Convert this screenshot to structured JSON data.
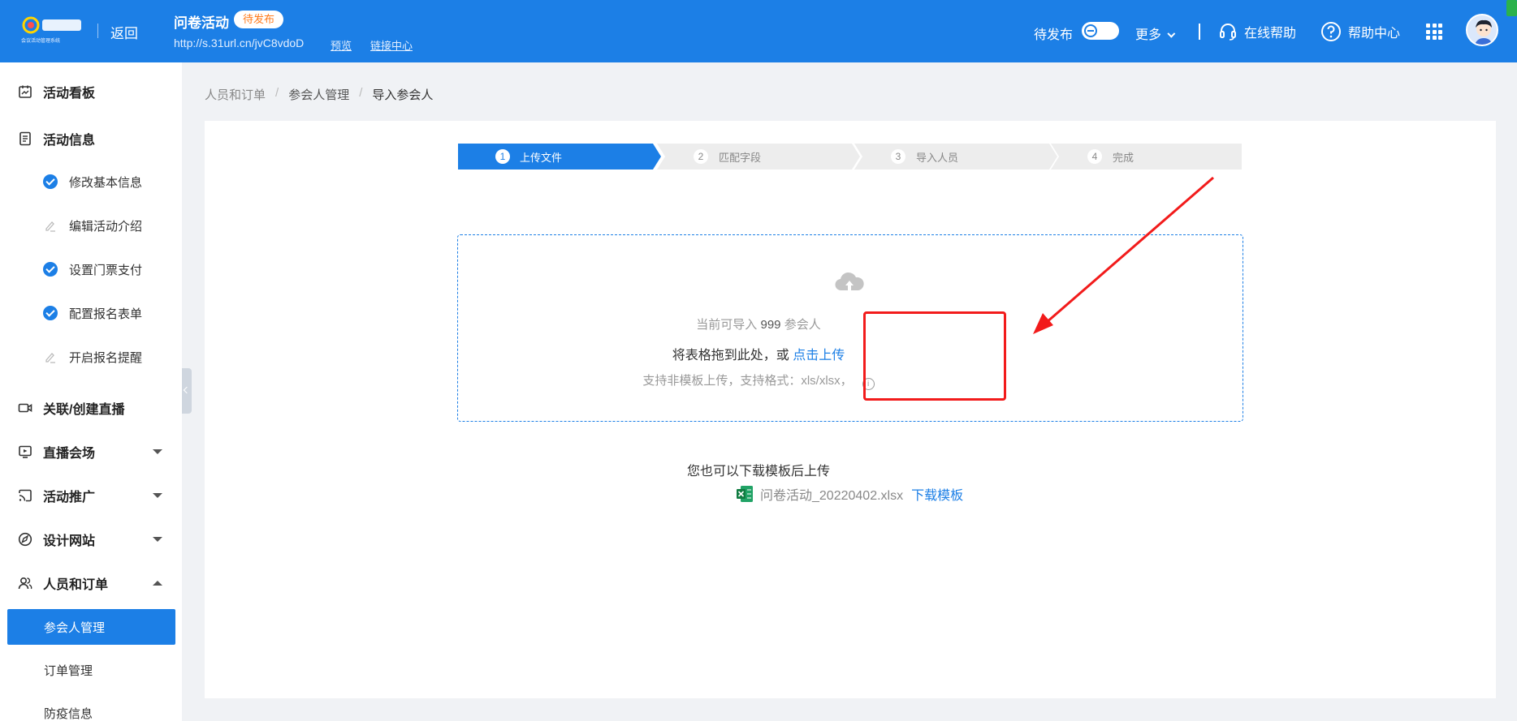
{
  "header": {
    "logo_text": "会议活动管理系统",
    "back_label": "返回",
    "activity_title": "问卷活动",
    "status_tag": "待发布",
    "activity_url": "http://s.31url.cn/jvC8vdoD",
    "preview_label": "预览",
    "link_center_label": "链接中心",
    "publish_label": "待发布",
    "more_label": "更多",
    "online_help_label": "在线帮助",
    "help_center_label": "帮助中心"
  },
  "sidebar": {
    "dashboard": "活动看板",
    "info": "活动信息",
    "info_children": [
      {
        "label": "修改基本信息",
        "icon": "check-circle-icon"
      },
      {
        "label": "编辑活动介绍",
        "icon": "pencil-icon"
      },
      {
        "label": "设置门票支付",
        "icon": "check-circle-icon"
      },
      {
        "label": "配置报名表单",
        "icon": "check-circle-icon"
      },
      {
        "label": "开启报名提醒",
        "icon": "pencil-icon"
      }
    ],
    "live": "关联/创建直播",
    "venue": "直播会场",
    "promotion": "活动推广",
    "website": "设计网站",
    "people": "人员和订单",
    "people_children": [
      "参会人管理",
      "订单管理",
      "防疫信息"
    ]
  },
  "breadcrumb": [
    "人员和订单",
    "参会人管理",
    "导入参会人"
  ],
  "steps": [
    {
      "num": "1",
      "label": "上传文件"
    },
    {
      "num": "2",
      "label": "匹配字段"
    },
    {
      "num": "3",
      "label": "导入人员"
    },
    {
      "num": "4",
      "label": "完成"
    }
  ],
  "upload": {
    "quota_prefix": "当前可导入",
    "quota_num": "999",
    "quota_suffix": "参会人",
    "drag_text": "将表格拖到此处，或",
    "click_upload": "点击上传",
    "format_text": "支持非模板上传，支持格式：xls/xlsx，",
    "info_glyph": "i"
  },
  "template": {
    "hint": "您也可以下载模板后上传",
    "filename": "问卷活动_20220402.xlsx",
    "download_label": "下载模板"
  },
  "colors": {
    "primary": "#1c7fe6",
    "annotation": "#f21b1b",
    "status_tag_text": "#ff7a1a",
    "excel_green": "#21a366"
  }
}
